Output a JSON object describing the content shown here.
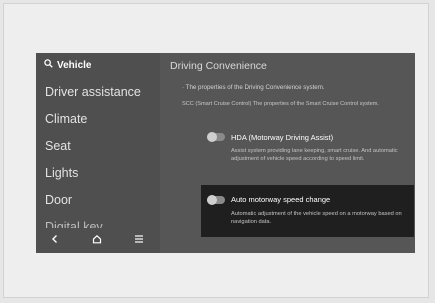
{
  "sidebar": {
    "header": {
      "icon": "search-icon",
      "label": "Vehicle"
    },
    "items": [
      {
        "label": "Driver assistance"
      },
      {
        "label": "Climate"
      },
      {
        "label": "Seat"
      },
      {
        "label": "Lights"
      },
      {
        "label": "Door"
      },
      {
        "label": "Digital key"
      }
    ]
  },
  "nav": [
    {
      "icon": "back-icon"
    },
    {
      "icon": "home-icon"
    },
    {
      "icon": "menu-icon"
    }
  ],
  "content": {
    "title": "Driving Convenience",
    "desc1": "· The properties of the Driving Convenience system.",
    "desc2": "SCC (Smart Cruise Control) The properties of the Smart Cruise Control system.",
    "options": [
      {
        "title": "HDA (Motorway Driving Assist)",
        "description": "Assist system providing lane keeping, smart cruise. And automatic adjustment of vehicle speed according to speed limit.",
        "enabled": false,
        "selected": false
      },
      {
        "title": "Auto motorway speed change",
        "description": "Automatic adjustment of the vehicle speed on a motorway based on navigation data.",
        "enabled": false,
        "selected": true
      }
    ]
  },
  "colors": {
    "screen": "#565656",
    "sidebar": "#4f4f4f",
    "selected_row": "#1f1f1f"
  }
}
